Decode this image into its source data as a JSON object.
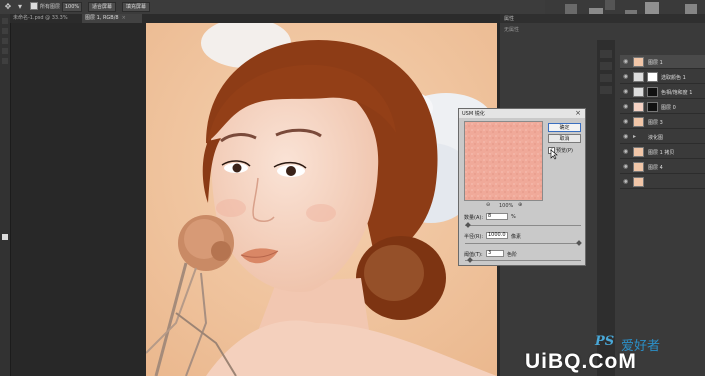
{
  "options_bar": {
    "checkbox_label": "所有图层",
    "zoom": "100%",
    "fit_screen": "适合屏幕",
    "fill_screen": "填充屏幕"
  },
  "tabs": [
    {
      "label": "未命名-1.psd @ 33.3% (RGB/8)",
      "active": false
    },
    {
      "label": "图层 1, RGB/8",
      "active": true
    }
  ],
  "panels": {
    "title": "属性",
    "subtitle": "无属性"
  },
  "layers": [
    {
      "name": "图层 1",
      "eye": true,
      "selected": true
    },
    {
      "name": "选取颜色 1",
      "eye": true
    },
    {
      "name": "色相/饱和度 1",
      "eye": true
    },
    {
      "name": "图层 0",
      "eye": true
    },
    {
      "name": "图层 3",
      "eye": true
    },
    {
      "name": "液化图",
      "eye": true
    },
    {
      "name": "图层 1 拷贝",
      "eye": true
    },
    {
      "name": "图层 4",
      "eye": true
    },
    {
      "name": "",
      "eye": true
    }
  ],
  "dialog": {
    "title": "USM 锐化",
    "ok": "确定",
    "cancel": "取消",
    "preview_label": "预览(P)",
    "preview_checked": true,
    "zoom": "100%",
    "amount_label": "数量(A):",
    "amount_value": "8",
    "amount_unit": "%",
    "radius_label": "半径(R):",
    "radius_value": "1000.0",
    "radius_unit": "像素",
    "threshold_label": "阈值(T):",
    "threshold_value": "3",
    "threshold_unit": "色阶"
  },
  "watermark": {
    "ps": "PS",
    "cn": "爱好者",
    "brand": "UiBQ.CoM"
  },
  "colors": {
    "background": "#f2c9a4",
    "hair": "#8a3b18",
    "skin": "#f4d2bf",
    "lips": "#d9876a",
    "dialog": "#c9c9c9"
  }
}
